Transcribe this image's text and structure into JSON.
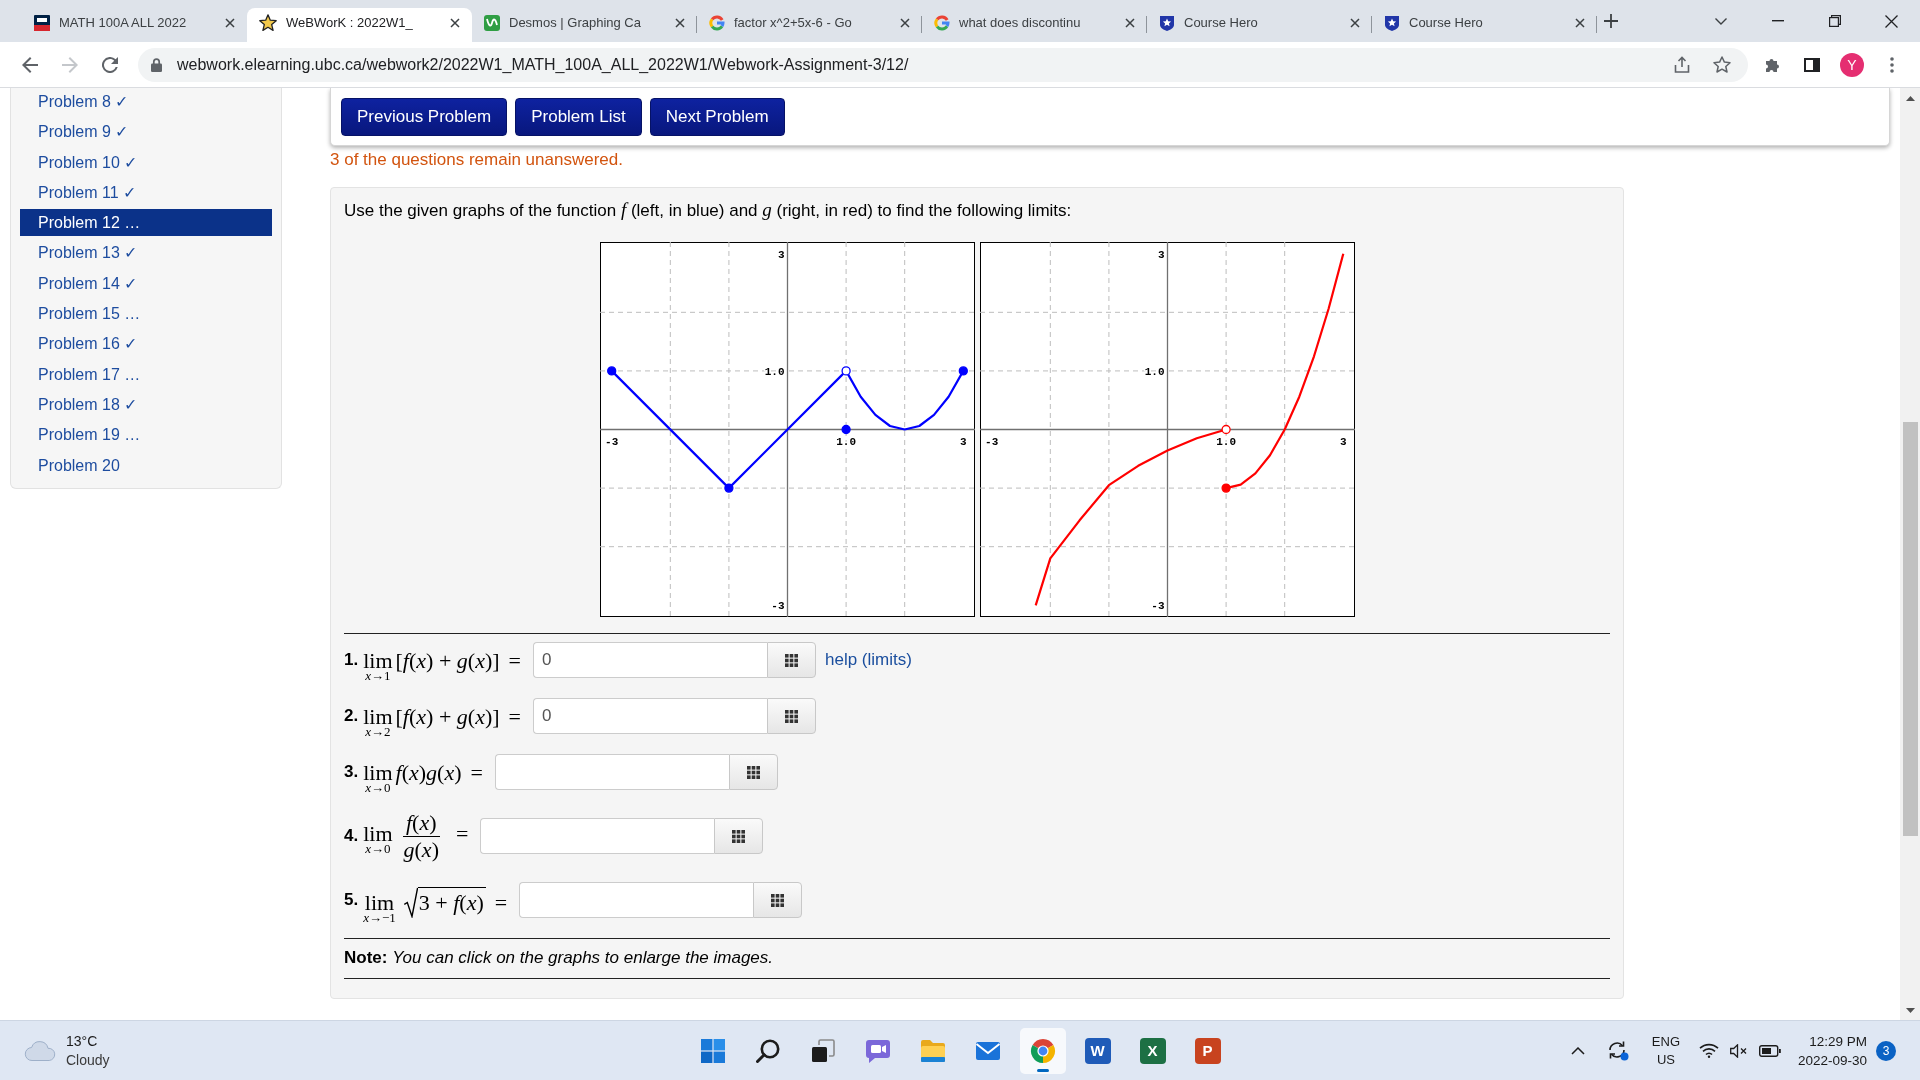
{
  "browser": {
    "tabs": [
      {
        "kind": "crest",
        "title": "MATH 100A ALL 2022",
        "selected": false
      },
      {
        "kind": "figure",
        "title": "WeBWorK : 2022W1_",
        "selected": true
      },
      {
        "kind": "graph",
        "title": "Desmos | Graphing Ca",
        "selected": false
      },
      {
        "kind": "letter",
        "title": "factor x^2+5x-6 - Go",
        "selected": false
      },
      {
        "kind": "letter",
        "title": "what does discontinu",
        "selected": false
      },
      {
        "kind": "badge",
        "title": "Course Hero",
        "selected": false
      },
      {
        "kind": "badge",
        "title": "Course Hero",
        "selected": false
      }
    ],
    "url": "webwork.elearning.ubc.ca/webwork2/2022W1_MATH_100A_ALL_2022W1/Webwork-Assignment-3/12/",
    "forward_disabled": true,
    "profile": "Y"
  },
  "sidebar": {
    "items": [
      {
        "label": "Problem 8 ✓",
        "selected": false
      },
      {
        "label": "Problem 9 ✓",
        "selected": false
      },
      {
        "label": "Problem 10 ✓",
        "selected": false
      },
      {
        "label": "Problem 11 ✓",
        "selected": false
      },
      {
        "label": "Problem 12 …",
        "selected": true
      },
      {
        "label": "Problem 13 ✓",
        "selected": false
      },
      {
        "label": "Problem 14 ✓",
        "selected": false
      },
      {
        "label": "Problem 15 …",
        "selected": false
      },
      {
        "label": "Problem 16 ✓",
        "selected": false
      },
      {
        "label": "Problem 17 …",
        "selected": false
      },
      {
        "label": "Problem 18 ✓",
        "selected": false
      },
      {
        "label": "Problem 19 …",
        "selected": false
      },
      {
        "label": "Problem 20",
        "selected": false
      }
    ]
  },
  "nav_buttons": [
    "Previous Problem",
    "Problem List",
    "Next Problem"
  ],
  "status_message": "3 of the questions remain unanswered.",
  "problem": {
    "statement": "Use the given graphs of the function *f* (left, in blue) and *g* (right, in red) to find the following limits:",
    "graphs": [
      {
        "chart_data": {
          "type": "line",
          "xlim": [
            -3.2,
            3.2
          ],
          "ylim": [
            -3.2,
            3.2
          ],
          "xticks": [
            {
              "value": -3,
              "label": "-3"
            },
            {
              "value": 1,
              "label": "1.0"
            },
            {
              "value": 3,
              "label": "3"
            }
          ],
          "yticks": [
            {
              "value": -3,
              "label": "-3"
            },
            {
              "value": 1,
              "label": "1.0"
            },
            {
              "value": 3,
              "label": "3"
            }
          ],
          "grid": true,
          "series": [
            {
              "color": "#0000ff",
              "x": [
                -3,
                -1,
                1,
                1.25,
                1.5,
                1.75,
                2,
                2.25,
                2.5,
                2.75,
                3
              ],
              "values": [
                1,
                -1,
                1,
                0.56,
                0.25,
                0.06,
                0,
                0.06,
                0.25,
                0.56,
                1
              ]
            },
            {
              "type": "scatter",
              "marker": "circle",
              "color": "#0000ff",
              "x": [
                -3,
                -1,
                1,
                3
              ],
              "values": [
                1,
                -1,
                0,
                1
              ]
            },
            {
              "type": "scatter",
              "marker": "circle",
              "color": "#ffffff",
              "x": [
                1
              ],
              "values": [
                1
              ]
            }
          ]
        }
      },
      {
        "chart_data": {
          "type": "line",
          "xlim": [
            -3.2,
            3.2
          ],
          "ylim": [
            -3.2,
            3.2
          ],
          "xticks": [
            {
              "value": -3,
              "label": "-3"
            },
            {
              "value": 1,
              "label": "1.0"
            },
            {
              "value": 3,
              "label": "3"
            }
          ],
          "yticks": [
            {
              "value": -3,
              "label": "-3"
            },
            {
              "value": 1,
              "label": "1.0"
            },
            {
              "value": 3,
              "label": "3"
            }
          ],
          "grid": true,
          "series": [
            {
              "color": "#ff0000",
              "x": [
                -2.25,
                -2,
                -1.5,
                -1,
                -0.5,
                0,
                0.5,
                1
              ],
              "values": [
                -3,
                -2.2,
                -1.55,
                -0.95,
                -0.62,
                -0.36,
                -0.15,
                0
              ]
            },
            {
              "color": "#ff0000",
              "x": [
                1,
                1.25,
                1.5,
                1.75,
                2,
                2.25,
                2.5,
                2.75,
                3
              ],
              "values": [
                -1,
                -0.94,
                -0.75,
                -0.44,
                0,
                0.56,
                1.25,
                2.06,
                3
              ]
            },
            {
              "type": "scatter",
              "marker": "circle",
              "color": "#ff0000",
              "x": [
                1
              ],
              "values": [
                -1
              ]
            },
            {
              "type": "scatter",
              "marker": "circle",
              "color": "#ffffff",
              "x": [
                1
              ],
              "values": [
                0
              ]
            }
          ]
        }
      }
    ],
    "questions": [
      {
        "number": "1.",
        "operator": "lim",
        "under": "*x*→1",
        "kind": "inline",
        "expression": "[*f*(*x*) + *g*(*x*)]",
        "equals": "=",
        "answer": "0",
        "help": "help (limits)"
      },
      {
        "number": "2.",
        "operator": "lim",
        "under": "*x*→2",
        "kind": "inline",
        "expression": "[*f*(*x*) + *g*(*x*)]",
        "equals": "=",
        "answer": "0"
      },
      {
        "number": "3.",
        "operator": "lim",
        "under": "*x*→0",
        "kind": "inline",
        "expression": "*f*(*x*)*g*(*x*)",
        "equals": "="
      },
      {
        "number": "4.",
        "operator": "lim",
        "under": "*x*→0",
        "kind": "fraction",
        "numerator": "*f*(*x*)",
        "denominator": "*g*(*x*)",
        "equals": "="
      },
      {
        "number": "5.",
        "operator": "lim",
        "under": "*x*→−1",
        "kind": "sqrt",
        "radicand": "3 + *f*(*x*)",
        "equals": "="
      }
    ],
    "note": "**Note:** *You can click on the graphs to enlarge the images.*"
  },
  "taskbar": {
    "weather": {
      "temperature": "13°C",
      "condition": "Cloudy"
    },
    "apps": [
      {
        "kind": "start",
        "selected": false
      },
      {
        "kind": "search",
        "selected": false
      },
      {
        "kind": "tasks",
        "selected": false
      },
      {
        "kind": "chat",
        "selected": false
      },
      {
        "kind": "files",
        "selected": false
      },
      {
        "kind": "mail",
        "selected": false
      },
      {
        "kind": "browser",
        "selected": true
      },
      {
        "kind": "word",
        "glyph": "W",
        "selected": false
      },
      {
        "kind": "excel",
        "glyph": "X",
        "selected": false
      },
      {
        "kind": "slides",
        "glyph": "P",
        "selected": false
      }
    ],
    "tray": {
      "language": "ENG",
      "region": "US",
      "time": "12:29 PM",
      "date": "2022-09-30",
      "notifications": "3"
    }
  }
}
